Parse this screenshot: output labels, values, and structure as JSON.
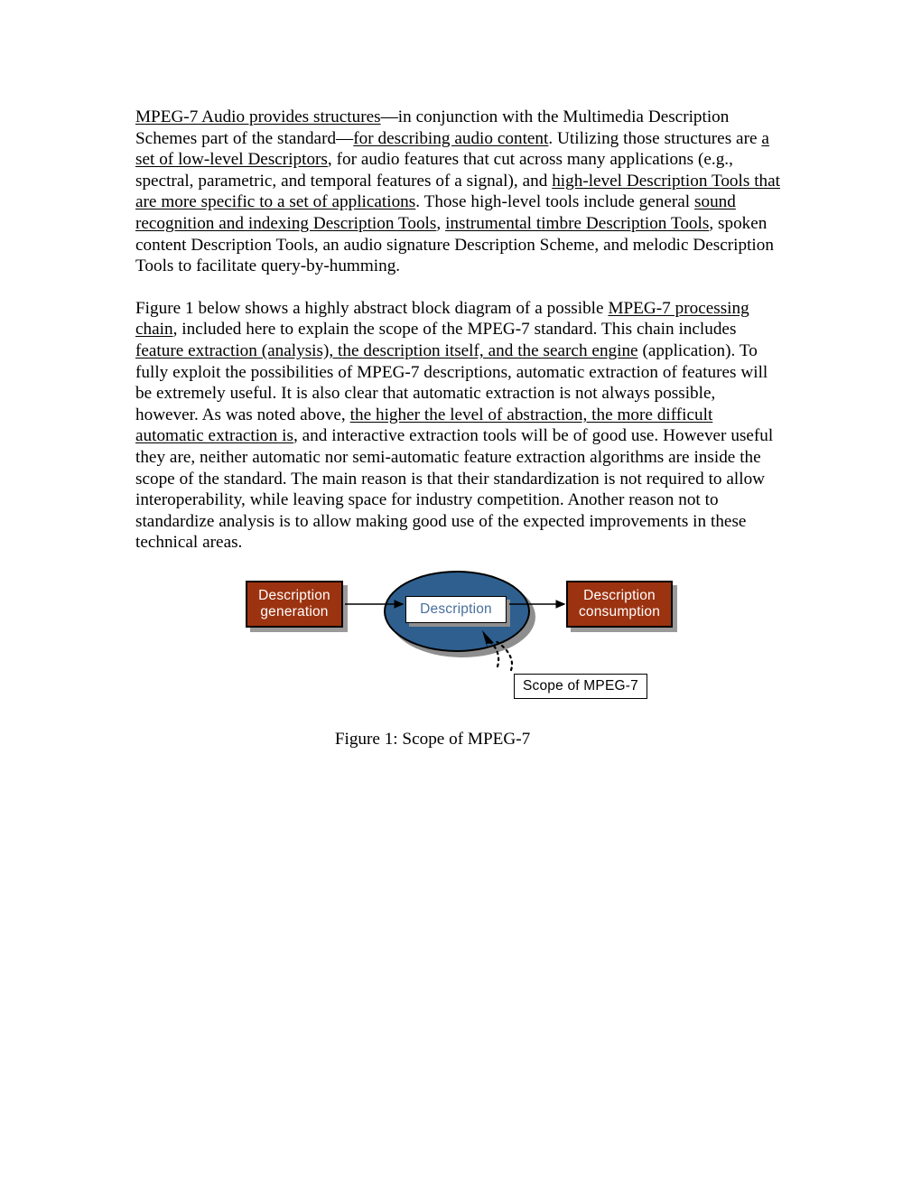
{
  "document": {
    "paragraphs": [
      {
        "id": "paragraph-audio-structures",
        "runs": [
          {
            "text": "MPEG-7 Audio provides structures",
            "underline": true
          },
          {
            "text": "—in conjunction with the Multimedia Description Schemes part of the standard—",
            "underline": false
          },
          {
            "text": "for describing audio content",
            "underline": true
          },
          {
            "text": ". Utilizing those structures are ",
            "underline": false
          },
          {
            "text": "a set of low-level Descriptors",
            "underline": true
          },
          {
            "text": ", for audio features that cut across many applications (e.g., spectral, parametric, and temporal features of a signal), and ",
            "underline": false
          },
          {
            "text": "high-level Description Tools that are more specific to a set of applications",
            "underline": true
          },
          {
            "text": ". Those high-level tools include general ",
            "underline": false
          },
          {
            "text": "sound recognition and indexing Description Tools",
            "underline": true
          },
          {
            "text": ", ",
            "underline": false
          },
          {
            "text": "instrumental timbre Description Tools",
            "underline": true
          },
          {
            "text": ", spoken content Description Tools, an audio signature Description Scheme, and melodic Description Tools to facilitate query-by-humming.",
            "underline": false
          }
        ]
      },
      {
        "id": "paragraph-processing-chain",
        "runs": [
          {
            "text": "Figure 1 below shows a highly abstract block diagram of a possible ",
            "underline": false
          },
          {
            "text": "MPEG-7 processing chain",
            "underline": true
          },
          {
            "text": ", included here to explain the scope of the MPEG-7 standard. This chain includes ",
            "underline": false
          },
          {
            "text": "feature extraction (analysis), the description itself, and the search engine",
            "underline": true
          },
          {
            "text": " (application). To fully exploit the possibilities of MPEG-7 descriptions, automatic extraction of features will be extremely useful. It is also clear that automatic extraction is not always possible, however. As was noted above, ",
            "underline": false
          },
          {
            "text": "the higher the level of abstraction, the more difficult automatic extraction is",
            "underline": true
          },
          {
            "text": ", and interactive extraction tools will be of good use. However useful they are, neither automatic nor semi-automatic feature extraction algorithms are inside the scope of the standard. The main reason is that their standardization is not required to allow interoperability, while leaving space for industry competition. Another reason not to standardize analysis is to allow making good use of the expected improvements in these technical areas.",
            "underline": false
          }
        ]
      }
    ]
  },
  "figure": {
    "caption": "Figure 1: Scope of MPEG-7",
    "blocks": {
      "generation_line1": "Description",
      "generation_line2": "generation",
      "consumption_line1": "Description",
      "consumption_line2": "consumption",
      "description_label": "Description",
      "scope_callout": "Scope of MPEG-7"
    },
    "colors": {
      "box_fill": "#9c3310",
      "box_text": "#ffffff",
      "ellipse_fill": "#2e5f8f",
      "shadow": "#8e8e8e",
      "label_text": "#4a6f9c",
      "outline": "#000000"
    }
  }
}
